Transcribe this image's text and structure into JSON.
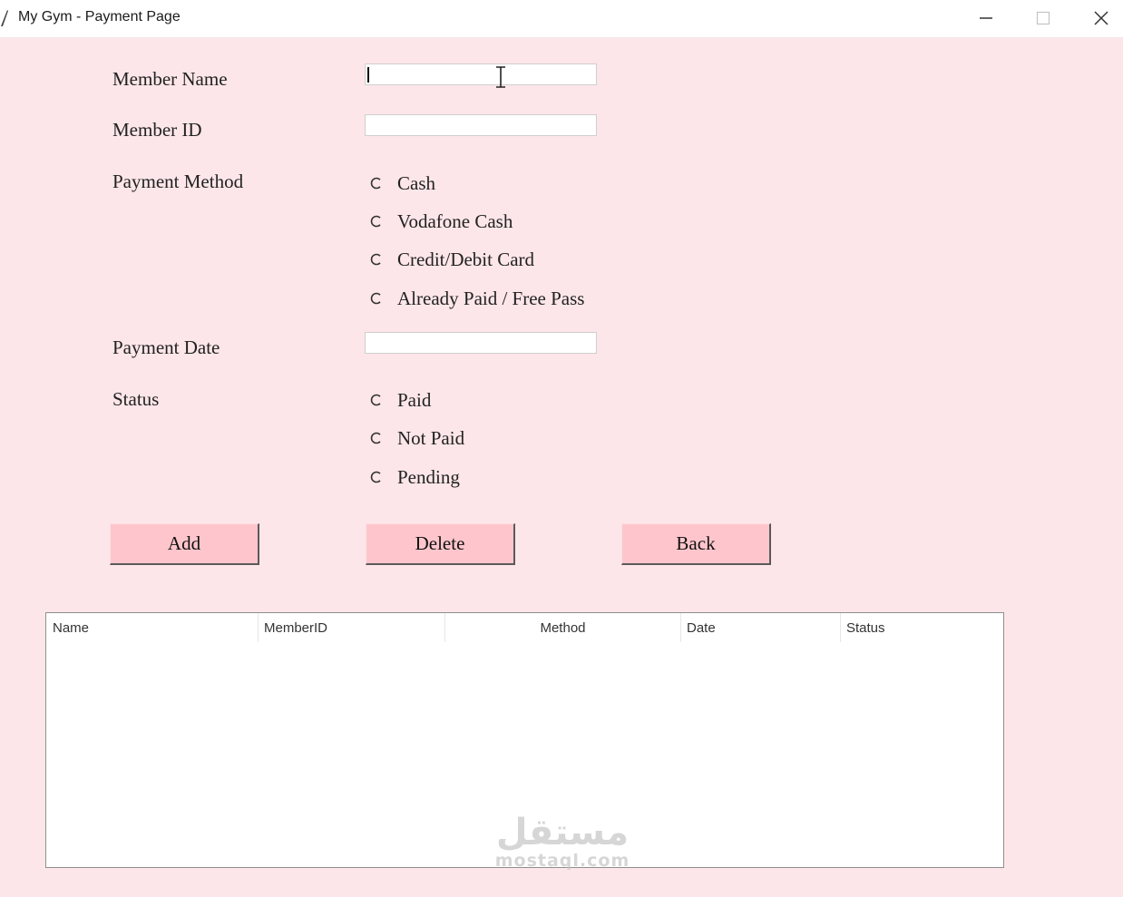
{
  "window": {
    "title": "My Gym - Payment Page",
    "controls": [
      "minimize-icon",
      "maximize-icon",
      "close-icon"
    ]
  },
  "form": {
    "member_name": {
      "label": "Member Name",
      "value": "",
      "focused": true
    },
    "member_id": {
      "label": "Member ID",
      "value": ""
    },
    "payment_method": {
      "label": "Payment Method",
      "options": [
        "Cash",
        "Vodafone Cash",
        "Credit/Debit Card",
        "Already Paid / Free Pass"
      ],
      "selected": null
    },
    "payment_date": {
      "label": "Payment Date",
      "value": ""
    },
    "status": {
      "label": "Status",
      "options": [
        "Paid",
        "Not Paid",
        "Pending"
      ],
      "selected": null
    }
  },
  "buttons": {
    "add": "Add",
    "delete": "Delete",
    "back": "Back"
  },
  "table": {
    "columns": [
      "Name",
      "MemberID",
      "Method",
      "Date",
      "Status"
    ],
    "rows": []
  },
  "watermark": {
    "arabic": "مستقل",
    "latin": "mostaql.com"
  },
  "colors": {
    "background": "#fde6e9",
    "button": "#fec6cc",
    "titlebar": "#ffffff"
  }
}
